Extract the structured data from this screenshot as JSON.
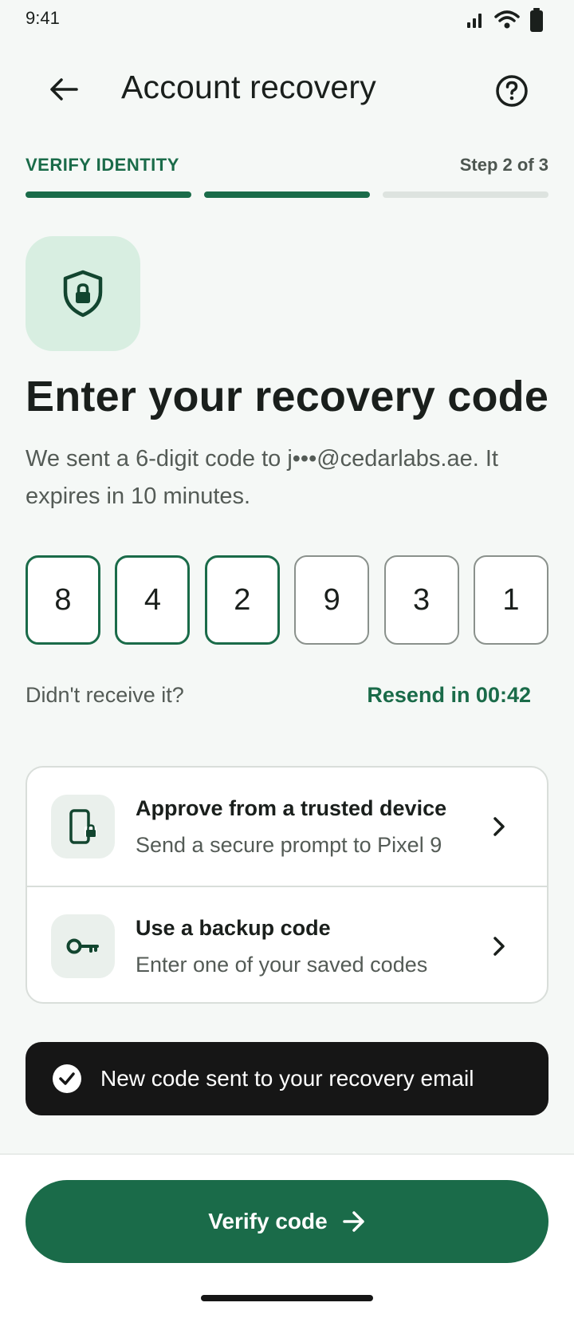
{
  "status_bar": {
    "time": "9:41"
  },
  "app_bar": {
    "title": "Account recovery"
  },
  "stepper": {
    "label": "VERIFY IDENTITY",
    "count": "Step 2 of 3",
    "total": 3,
    "completed": 2
  },
  "content": {
    "headline": "Enter your recovery code",
    "description": "We sent a 6-digit code to j•••@cedarlabs.ae. It expires in 10 minutes."
  },
  "otp": {
    "digits": [
      "8",
      "4",
      "2",
      "9",
      "3",
      "1"
    ]
  },
  "resend": {
    "prompt": "Didn't receive it?",
    "timer": "Resend in 00:42"
  },
  "options": [
    {
      "title": "Approve from a trusted device",
      "subtitle": "Send a secure prompt to Pixel 9",
      "icon": "phone-lock-icon"
    },
    {
      "title": "Use a backup code",
      "subtitle": "Enter one of your saved codes",
      "icon": "key-icon"
    }
  ],
  "snackbar": {
    "text": "New code sent to your recovery email"
  },
  "primary_action": {
    "label": "Verify code"
  },
  "colors": {
    "accent": "#1a6b49",
    "accent_soft": "#d8eee1",
    "background": "#f5f8f6",
    "snackbar": "#161616"
  }
}
